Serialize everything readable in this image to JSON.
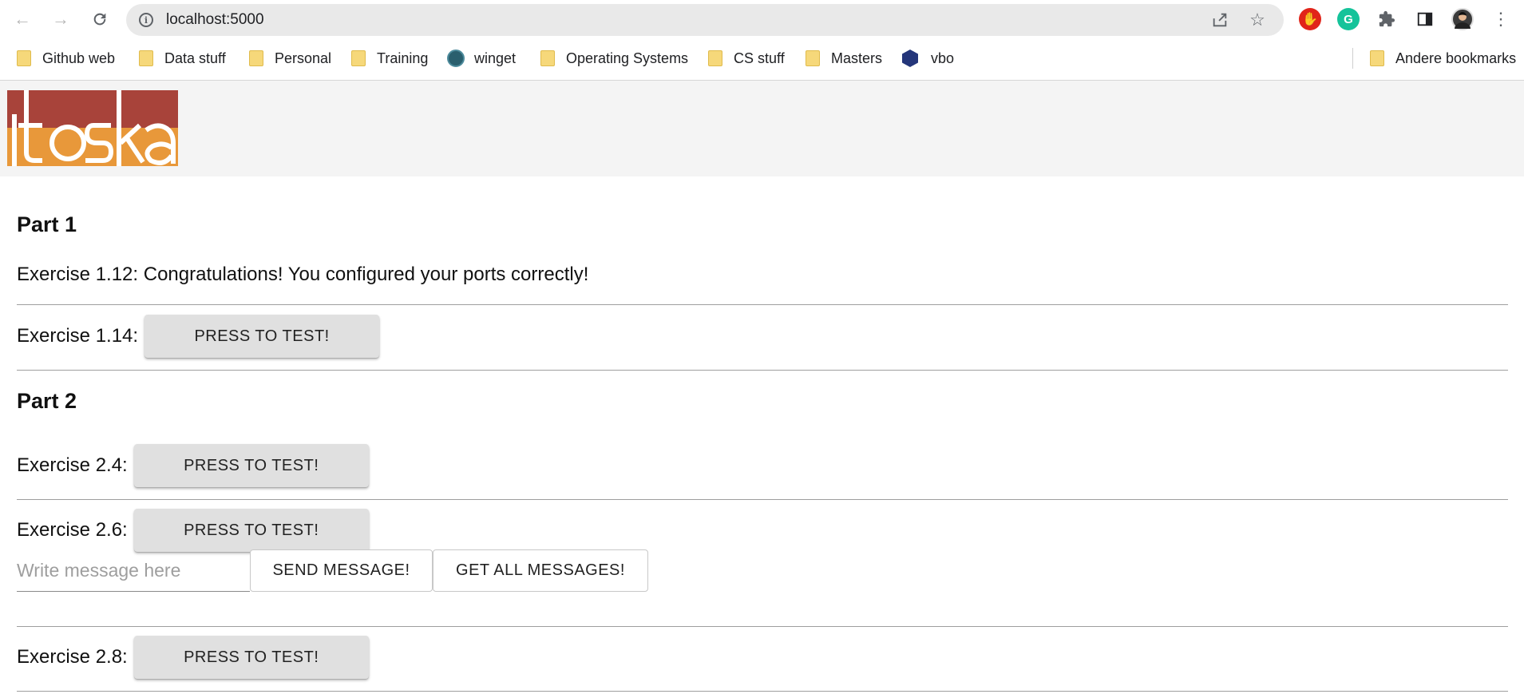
{
  "browser": {
    "url": "localhost:5000",
    "bookmarks": [
      {
        "label": "Github web",
        "icon": "folder-icon"
      },
      {
        "label": "Data stuff",
        "icon": "folder-icon"
      },
      {
        "label": "Personal",
        "icon": "folder-icon"
      },
      {
        "label": "Training",
        "icon": "folder-icon"
      },
      {
        "label": "winget",
        "icon": "globe-icon"
      },
      {
        "label": "Operating Systems",
        "icon": "folder-icon"
      },
      {
        "label": "CS stuff",
        "icon": "folder-icon"
      },
      {
        "label": "Masters",
        "icon": "folder-icon"
      },
      {
        "label": "vbo",
        "icon": "hexagon-icon"
      }
    ],
    "other_bookmarks": "Andere bookmarks"
  },
  "logo": {
    "text": "itoska",
    "colors": {
      "top": "#a8433a",
      "bottom": "#e8983a"
    }
  },
  "part1": {
    "title": "Part 1",
    "ex_1_12": "Exercise 1.12: Congratulations! You configured your ports correctly!",
    "ex_1_14_label": "Exercise 1.14:",
    "ex_1_14_button": "PRESS TO TEST!"
  },
  "part2": {
    "title": "Part 2",
    "ex_2_4_label": "Exercise 2.4:",
    "ex_2_4_button": "PRESS TO TEST!",
    "ex_2_6_label": "Exercise 2.6:",
    "ex_2_6_button": "PRESS TO TEST!",
    "message_placeholder": "Write message here",
    "message_value": "",
    "send_button": "SEND MESSAGE!",
    "get_all_button": "GET ALL MESSAGES!",
    "ex_2_8_label": "Exercise 2.8:",
    "ex_2_8_button": "PRESS TO TEST!"
  }
}
